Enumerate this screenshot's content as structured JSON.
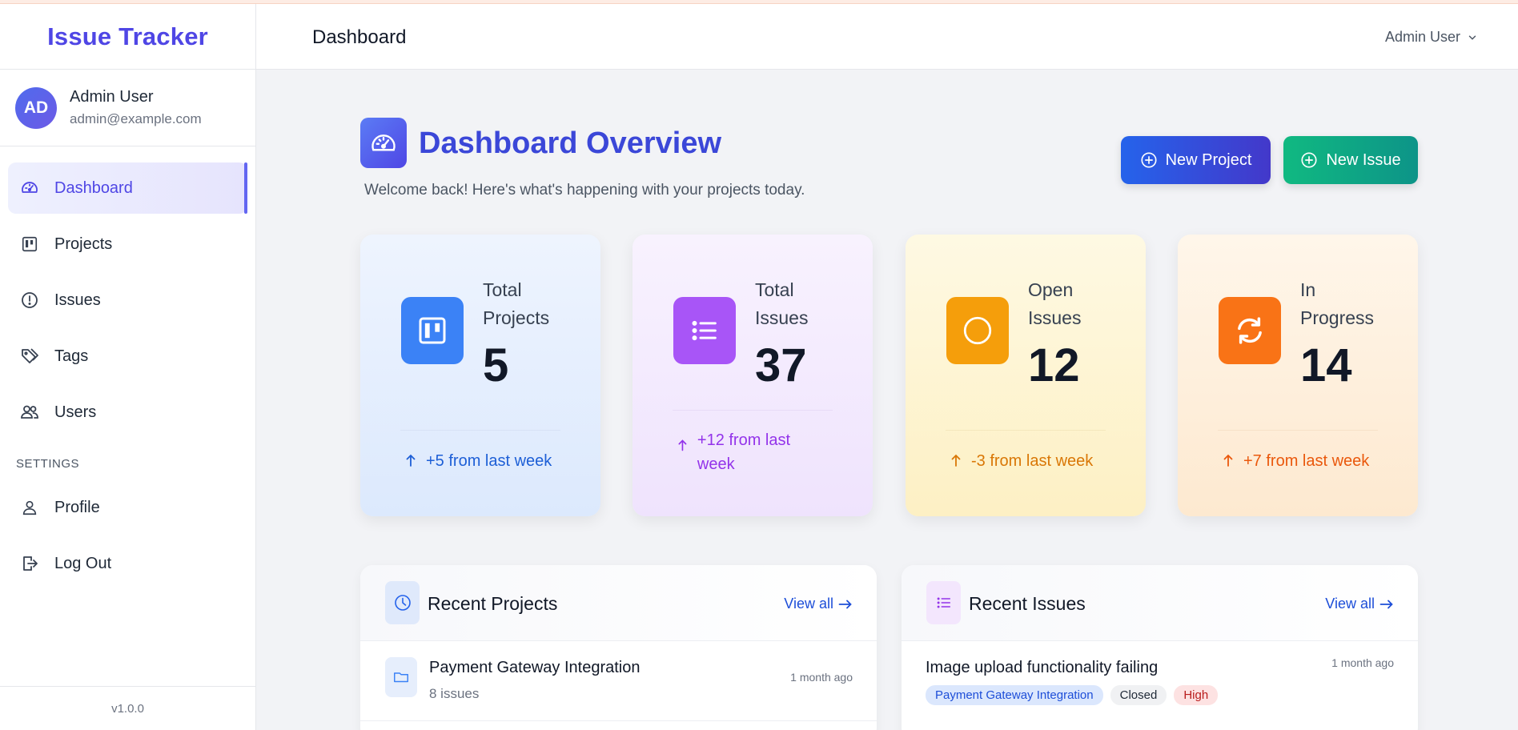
{
  "app": {
    "title": "Issue Tracker",
    "version": "v1.0.0"
  },
  "user": {
    "initials": "AD",
    "name": "Admin User",
    "email": "admin@example.com"
  },
  "sidebar": {
    "items": [
      {
        "label": "Dashboard",
        "icon": "gauge-icon",
        "active": true
      },
      {
        "label": "Projects",
        "icon": "kanban-icon"
      },
      {
        "label": "Issues",
        "icon": "alert-circle-icon"
      },
      {
        "label": "Tags",
        "icon": "tag-icon"
      },
      {
        "label": "Users",
        "icon": "users-icon"
      }
    ],
    "settings_label": "SETTINGS",
    "settings_items": [
      {
        "label": "Profile",
        "icon": "person-icon"
      },
      {
        "label": "Log Out",
        "icon": "logout-icon"
      }
    ]
  },
  "header": {
    "title": "Dashboard",
    "user_menu": "Admin User"
  },
  "main": {
    "title": "Dashboard Overview",
    "subtitle": "Welcome back! Here's what's happening with your projects today.",
    "new_project_label": "New Project",
    "new_issue_label": "New Issue"
  },
  "stats": [
    {
      "label": "Total Projects",
      "value": "5",
      "change": "+5 from last week",
      "icon": "kanban-icon",
      "color": "#3b82f6"
    },
    {
      "label": "Total Issues",
      "value": "37",
      "change": "+12 from last week",
      "icon": "list-icon",
      "color": "#a855f7"
    },
    {
      "label": "Open Issues",
      "value": "12",
      "change": "-3 from last week",
      "icon": "circle-icon",
      "color": "#f59e0b"
    },
    {
      "label": "In Progress",
      "value": "14",
      "change": "+7 from last week",
      "icon": "refresh-icon",
      "color": "#f97316"
    }
  ],
  "recent_projects": {
    "title": "Recent Projects",
    "view_all": "View all",
    "items": [
      {
        "name": "Payment Gateway Integration",
        "count": "8 issues",
        "time": "1 month ago"
      }
    ]
  },
  "recent_issues": {
    "title": "Recent Issues",
    "view_all": "View all",
    "items": [
      {
        "title": "Image upload functionality failing",
        "project": "Payment Gateway Integration",
        "status": "Closed",
        "priority": "High",
        "time": "1 month ago"
      }
    ]
  }
}
